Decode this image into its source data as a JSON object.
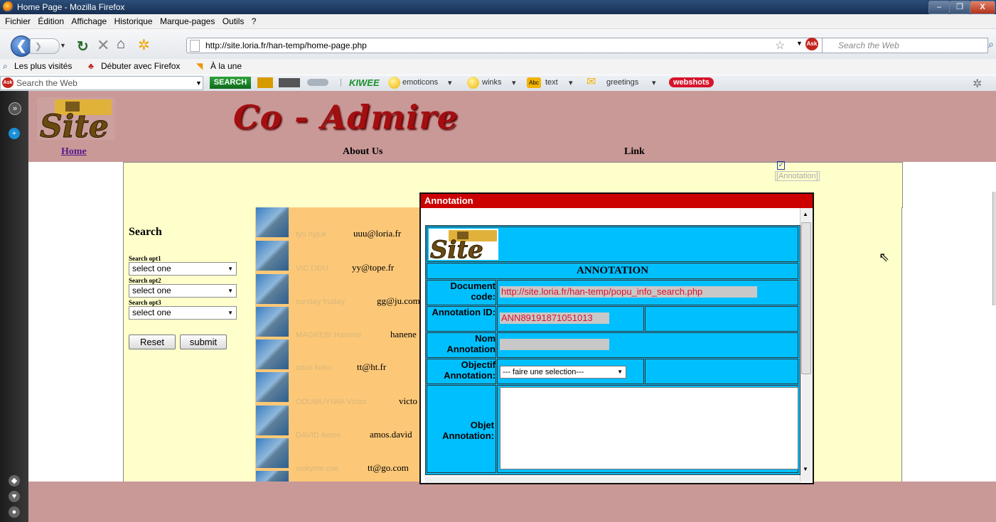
{
  "window": {
    "title": "Home Page - Mozilla Firefox",
    "minimize": "–",
    "maximize": "❐",
    "close": "X"
  },
  "menu": [
    "Fichier",
    "Édition",
    "Affichage",
    "Historique",
    "Marque-pages",
    "Outils",
    "?"
  ],
  "nav": {
    "url": "http://site.loria.fr/han-temp/home-page.php",
    "search_placeholder": "Search the Web"
  },
  "bookmarks": [
    "Les plus visités",
    "Débuter avec Firefox",
    "À la une"
  ],
  "ask_toolbar": {
    "placeholder": "Search the Web",
    "search_button": "SEARCH",
    "brand": "KIWEE",
    "items": [
      "emoticons",
      "winks",
      "text",
      "greetings"
    ],
    "webshots": "webshots"
  },
  "page": {
    "brand": "Co - Admire",
    "nav": [
      "Home",
      "About Us",
      "Link"
    ],
    "annotation_link": "[Annotation]",
    "search": {
      "title": "Search",
      "options": [
        {
          "label": "Search opt1",
          "value": "select one"
        },
        {
          "label": "Search opt2",
          "value": "select one"
        },
        {
          "label": "Search opt3",
          "value": "select one"
        }
      ],
      "reset": "Reset",
      "submit": "submit"
    },
    "users": [
      {
        "name": "tyu  hyjuk",
        "email": "uuu@loria.fr"
      },
      {
        "name": "VIC  ODU",
        "email": "yy@tope.fr"
      },
      {
        "name": "sunday  fruday",
        "email": "gg@ju.com"
      },
      {
        "name": "MAGREBI  Hanene",
        "email": "hanene"
      },
      {
        "name": "odus  koko",
        "email": "tt@ht.fr"
      },
      {
        "name": "ODUMUYIWA  Victor",
        "email": "victo"
      },
      {
        "name": "DAVID  Amos",
        "email": "amos.david"
      },
      {
        "name": "vickyme  ose",
        "email": "tt@go.com"
      }
    ]
  },
  "dialog": {
    "title": "Annotation",
    "heading": "ANNOTATION",
    "fields": {
      "document_code_label": "Document code:",
      "document_code_value": "http://site.loria.fr/han-temp/popu_info_search.php",
      "annotation_id_label": "Annotation ID:",
      "annotation_id_value": "ANN89191871051013",
      "nom_label": "Nom Annotation",
      "nom_value": "",
      "objectif_label": "Objectif Annotation:",
      "objectif_value": "--- faire une selection---",
      "objet_label": "Objet Annotation:"
    }
  }
}
